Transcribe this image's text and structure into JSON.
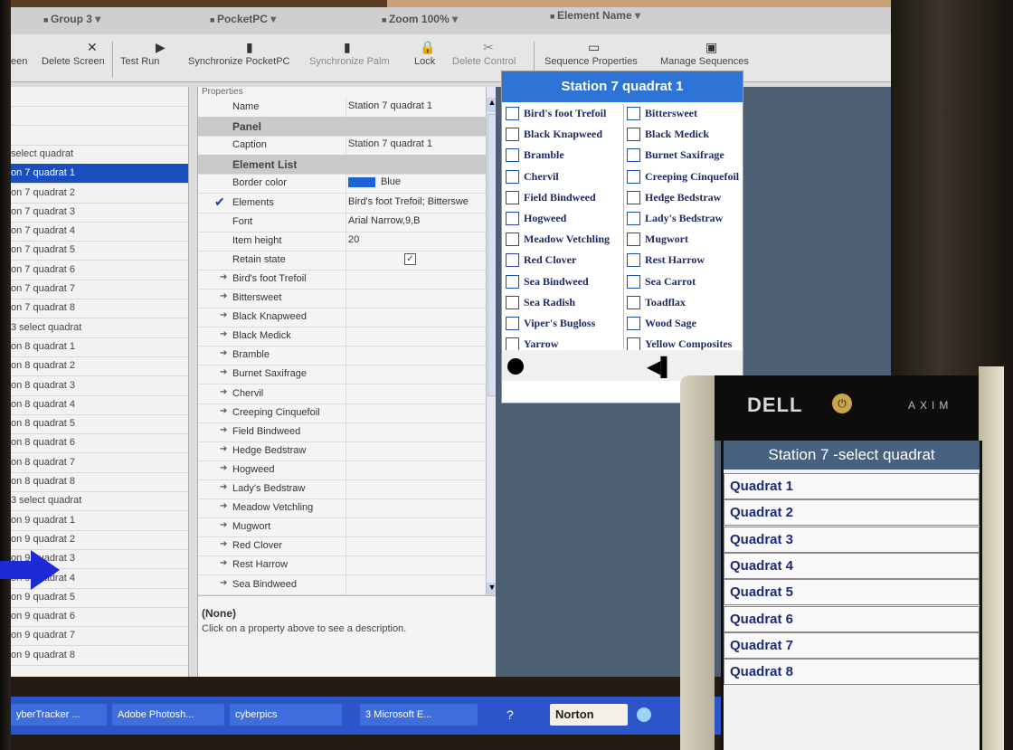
{
  "toolbar": {
    "dropdowns": [
      "Group 3",
      "PocketPC",
      "Zoom 100%",
      "Element Name"
    ],
    "buttons": [
      {
        "label": "een",
        "icon": "screen-icon"
      },
      {
        "label": "Delete Screen",
        "icon": "x-icon"
      },
      {
        "label": "Test Run",
        "icon": "play-icon"
      },
      {
        "label": "Synchronize PocketPC",
        "icon": "device-icon"
      },
      {
        "label": "Synchronize Palm",
        "icon": "device-icon"
      },
      {
        "label": "Lock",
        "icon": "lock-icon"
      },
      {
        "label": "Delete Control",
        "icon": "delete-icon"
      },
      {
        "label": "Sequence Properties",
        "icon": "window-icon"
      },
      {
        "label": "Manage Sequences",
        "icon": "window-icon"
      }
    ]
  },
  "screen_list": {
    "items": [
      "",
      "",
      "",
      "select quadrat",
      "on 7 quadrat 1",
      "on 7 quadrat 2",
      "on 7 quadrat 3",
      "on 7 quadrat 4",
      "on 7 quadrat 5",
      "on 7 quadrat 6",
      "on 7 quadrat 7",
      "on 7 quadrat 8",
      "3 select quadrat",
      "on 8 quadrat 1",
      "on 8 quadrat 2",
      "on 8 quadrat 3",
      "on 8 quadrat 4",
      "on 8 quadrat 5",
      "on 8 quadrat 6",
      "on 8 quadrat 7",
      "on 8 quadrat 8",
      "3 select quadrat",
      "on 9 quadrat 1",
      "on 9 quadrat 2",
      "on 9 quadrat 3",
      "on 9 quadrat 4",
      "on 9 quadrat 5",
      "on 9 quadrat 6",
      "on 9 quadrat 7",
      "on 9 quadrat 8"
    ],
    "selected_index": 4
  },
  "properties": {
    "header": "Properties",
    "rows": [
      {
        "key": "Name",
        "value": "Station 7 quadrat 1"
      },
      {
        "key": "Panel",
        "category": true
      },
      {
        "key": "Caption",
        "value": "Station 7 quadrat 1"
      },
      {
        "key": "Element List",
        "category": true
      },
      {
        "key": "Border color",
        "value": "Blue",
        "swatch": "#1e63d6"
      },
      {
        "key": "Elements",
        "value": "Bird's foot Trefoil; Bitterswe",
        "check": true
      },
      {
        "key": "Font",
        "value": "Arial Narrow,9,B"
      },
      {
        "key": "Item height",
        "value": "20"
      },
      {
        "key": "Retain state",
        "value": "✓"
      },
      {
        "key": "Bird's foot Trefoil",
        "arrow": true
      },
      {
        "key": "Bittersweet",
        "arrow": true
      },
      {
        "key": "Black Knapweed",
        "arrow": true
      },
      {
        "key": "Black Medick",
        "arrow": true
      },
      {
        "key": "Bramble",
        "arrow": true
      },
      {
        "key": "Burnet Saxifrage",
        "arrow": true
      },
      {
        "key": "Chervil",
        "arrow": true
      },
      {
        "key": "Creeping Cinquefoil",
        "arrow": true
      },
      {
        "key": "Field Bindweed",
        "arrow": true
      },
      {
        "key": "Hedge Bedstraw",
        "arrow": true
      },
      {
        "key": "Hogweed",
        "arrow": true
      },
      {
        "key": "Lady's Bedstraw",
        "arrow": true
      },
      {
        "key": "Meadow Vetchling",
        "arrow": true
      },
      {
        "key": "Mugwort",
        "arrow": true
      },
      {
        "key": "Red Clover",
        "arrow": true
      },
      {
        "key": "Rest Harrow",
        "arrow": true
      },
      {
        "key": "Sea Bindweed",
        "arrow": true
      }
    ],
    "description_title": "(None)",
    "description_text": "Click on a property above to see a description."
  },
  "designer": {
    "title": "Station 7 quadrat 1",
    "col1": [
      "Bird's foot Trefoil",
      "Black Knapweed",
      "Bramble",
      "Chervil",
      "Field Bindweed",
      "Hogweed",
      "Meadow Vetchling",
      "Red Clover",
      "Sea Bindweed",
      "Sea Radish",
      "Viper's Bugloss",
      "Yarrow"
    ],
    "col2": [
      "Bittersweet",
      "Black Medick",
      "Burnet Saxifrage",
      "Creeping Cinquefoil",
      "Hedge Bedstraw",
      "Lady's Bedstraw",
      "Mugwort",
      "Rest Harrow",
      "Sea Carrot",
      "Toadflax",
      "Wood Sage",
      "Yellow Composites"
    ]
  },
  "taskbar": {
    "items": [
      "yberTracker ...",
      "Adobe Photosh...",
      "cyberpics",
      "3 Microsoft E...",
      "Norton"
    ]
  },
  "pda": {
    "brand": "DELL",
    "model": "AXIM",
    "title": "Station 7 -select quadrat",
    "items": [
      "Quadrat 1",
      "Quadrat 2",
      "Quadrat 3",
      "Quadrat 4",
      "Quadrat 5",
      "Quadrat 6",
      "Quadrat 7",
      "Quadrat 8"
    ]
  },
  "colors": {
    "accent": "#2d74d6",
    "selection": "#1a4fbf",
    "pointer": "#1d2bd6"
  }
}
